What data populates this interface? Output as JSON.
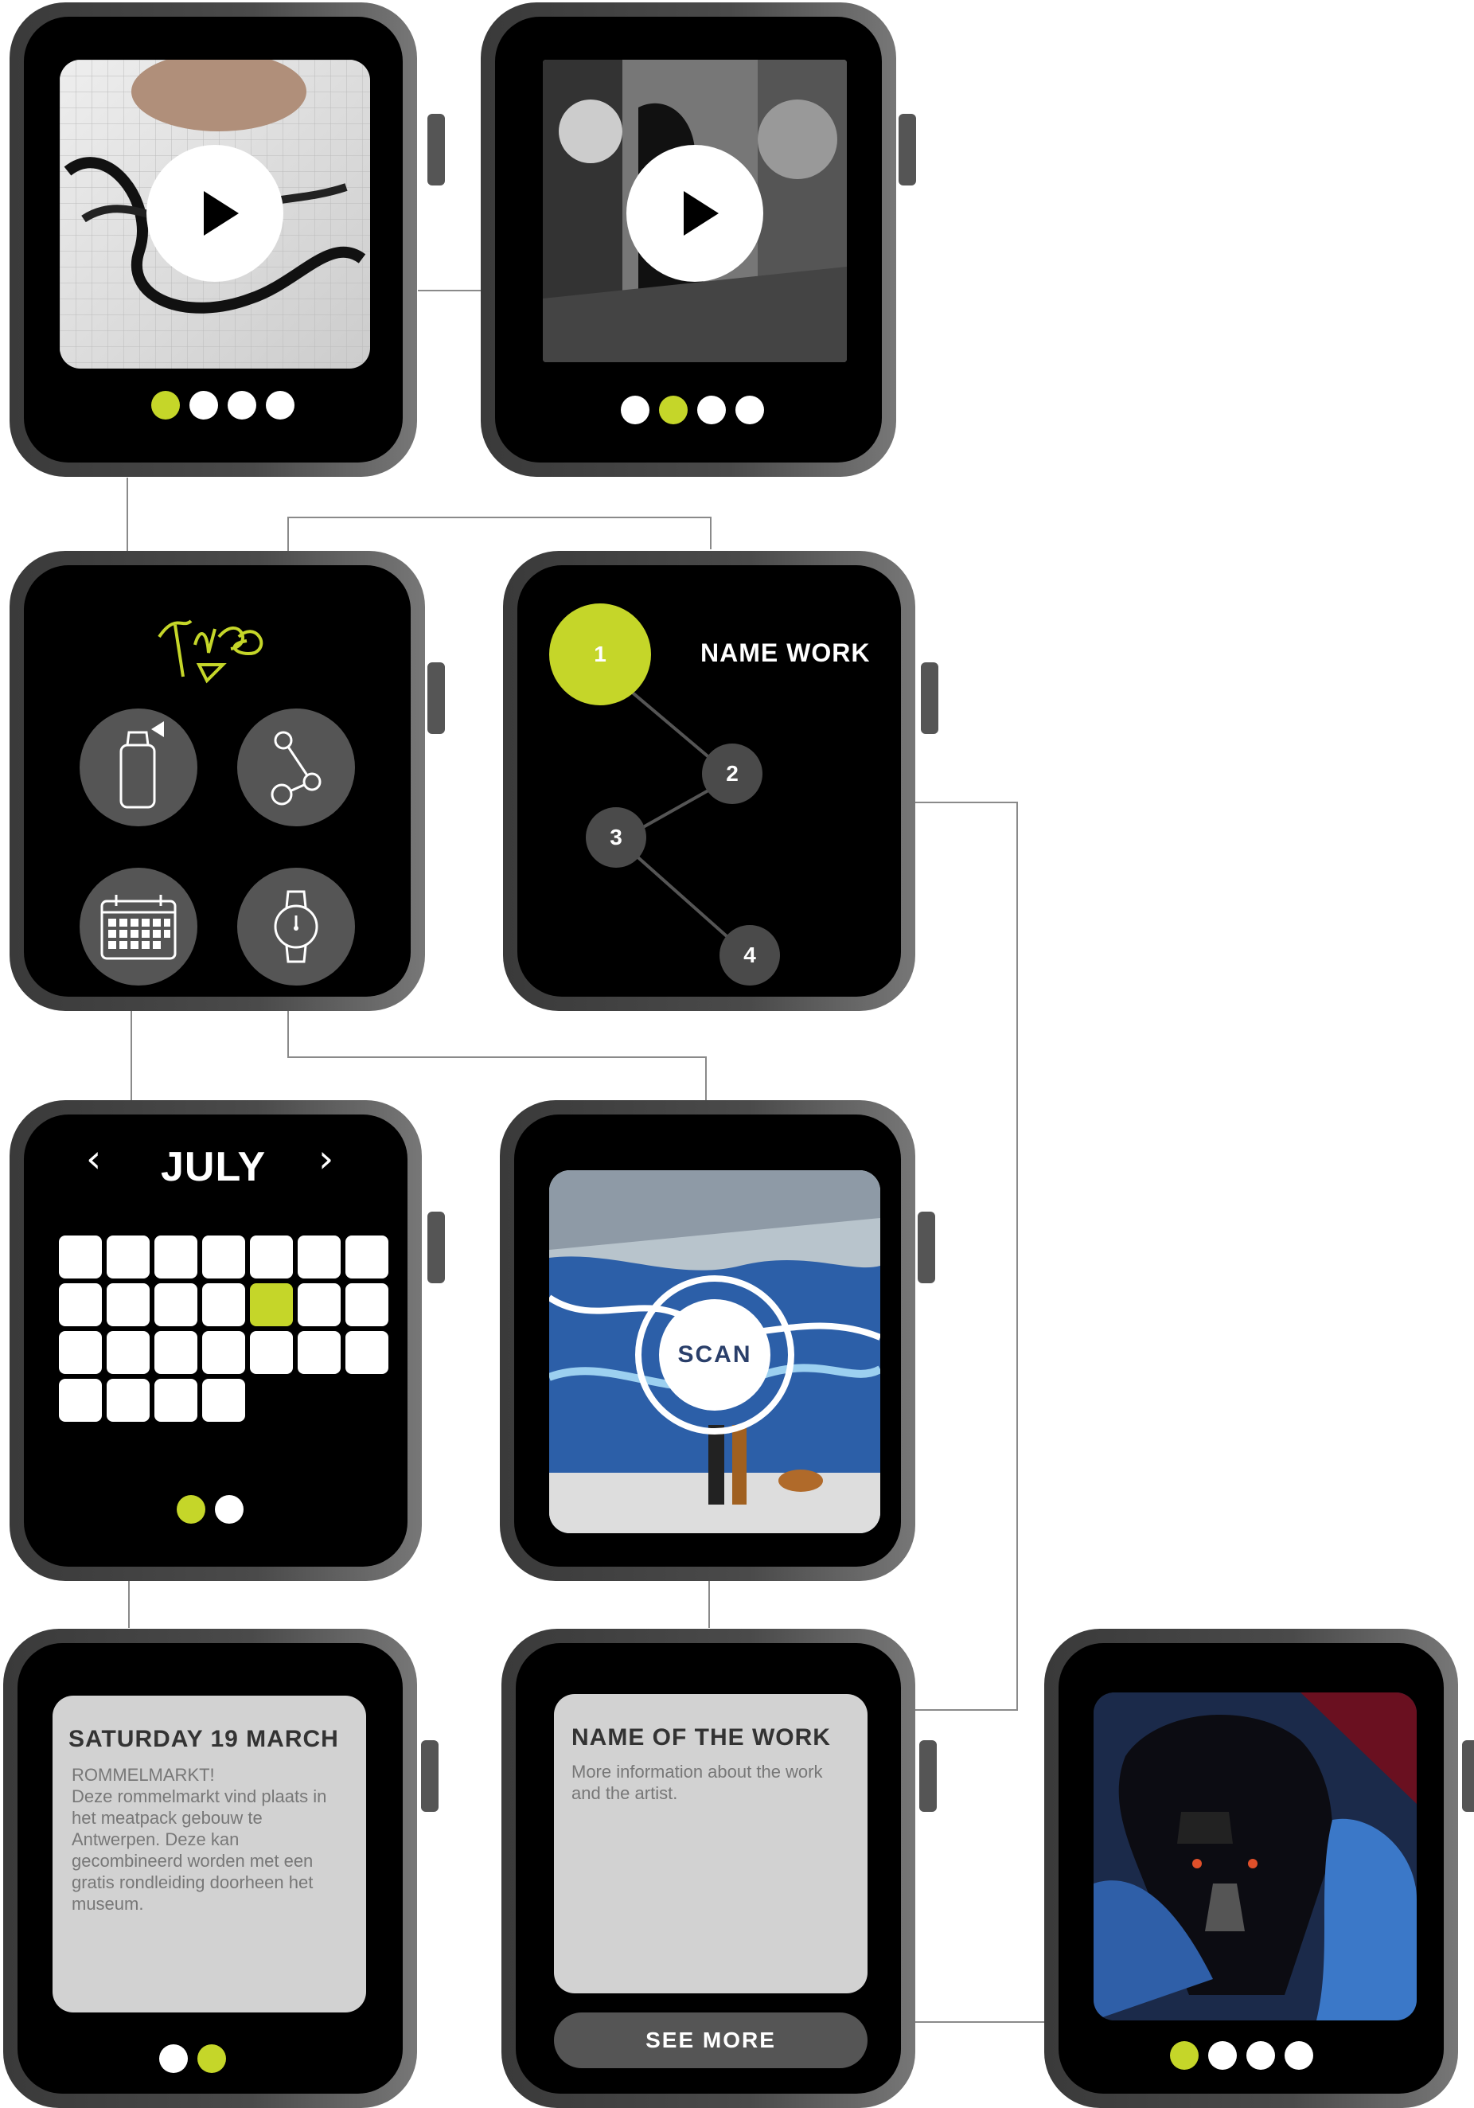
{
  "colors": {
    "accent": "#c5d629",
    "watch_body": "#4a4a4a",
    "screen": "#000000",
    "card": "#d2d2d2"
  },
  "watch1": {
    "media": "video-drawing",
    "play_icon": "play-icon",
    "pager_active": 0,
    "pager_count": 4
  },
  "watch2": {
    "media": "video-graffiti-artist",
    "play_icon": "play-icon",
    "pager_active": 1,
    "pager_count": 4
  },
  "watch3": {
    "logo": "tag-logo",
    "buttons": [
      "spray-can-icon",
      "share-icon",
      "calendar-icon",
      "watch-icon"
    ]
  },
  "watch4": {
    "title": "NAME WORK",
    "nodes": [
      "1",
      "2",
      "3",
      "4"
    ],
    "active_node": "1"
  },
  "watch5": {
    "month": "JULY",
    "prev_icon": "chevron-left-icon",
    "next_icon": "chevron-right-icon",
    "day_cells": 25,
    "selected_index": 11,
    "pager_active": 0,
    "pager_count": 2
  },
  "watch6": {
    "media": "graffiti-wall-photo",
    "scan_label": "SCAN"
  },
  "watch7": {
    "title": "SATURDAY 19 MARCH",
    "body": "ROMMELMARKT!\nDeze rommelmarkt vind plaats in het meatpack gebouw te Antwerpen. Deze kan gecombineerd worden met een gratis rondleiding doorheen het museum.",
    "pager_active": 1,
    "pager_count": 2
  },
  "watch8": {
    "title": "NAME OF THE WORK",
    "body": "More information about the work and the artist.",
    "button": "SEE MORE"
  },
  "watch9": {
    "media": "darth-vader-graffiti",
    "pager_active": 0,
    "pager_count": 4
  }
}
